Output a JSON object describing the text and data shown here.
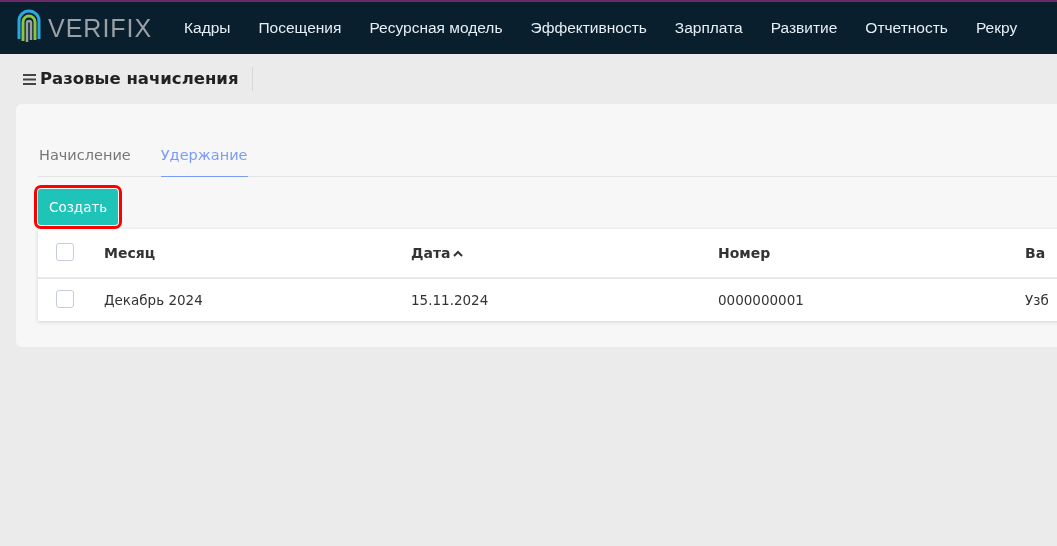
{
  "brand": {
    "name": "VERIFIX"
  },
  "nav": [
    "Кадры",
    "Посещения",
    "Ресурсная модель",
    "Эффективность",
    "Зарплата",
    "Развитие",
    "Отчетность",
    "Рекру"
  ],
  "page": {
    "title": "Разовые начисления"
  },
  "tabs": [
    {
      "label": "Начисление",
      "selected": false
    },
    {
      "label": "Удержание",
      "selected": true
    }
  ],
  "create_button": {
    "label": "Создать",
    "highlighted": true
  },
  "table": {
    "select_all": {
      "checked": false
    },
    "columns": [
      {
        "label": "Месяц",
        "sorted": false
      },
      {
        "label": "Дата",
        "sorted": true
      },
      {
        "label": "Номер",
        "sorted": false
      },
      {
        "label": "Ва",
        "sorted": false
      }
    ],
    "rows": [
      {
        "checked": false,
        "cells": [
          "Декабрь 2024",
          "15.11.2024",
          "0000000001",
          "Узб"
        ]
      }
    ]
  }
}
